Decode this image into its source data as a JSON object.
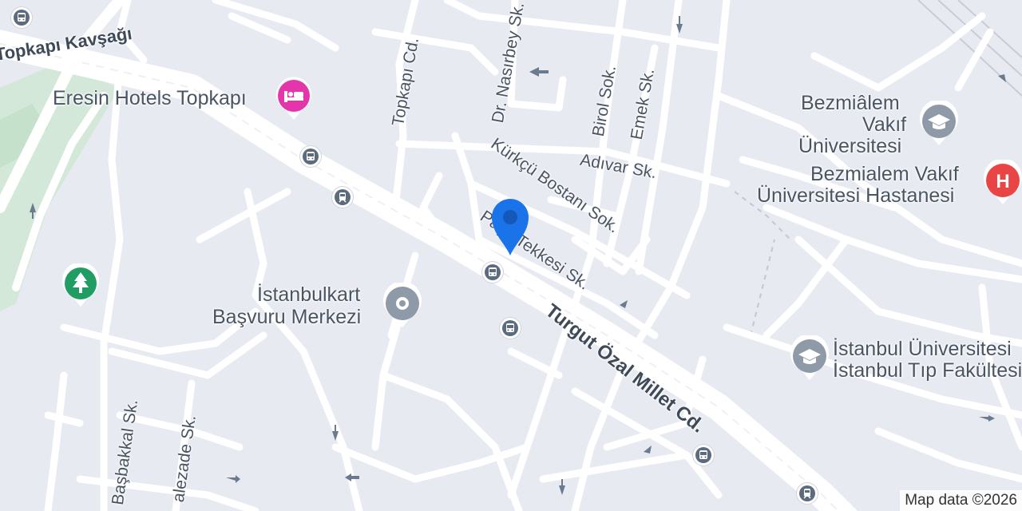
{
  "streets": {
    "topkapi_kavsagi": "Topkapı Kavşağı",
    "topkapi_cd": "Topkapı Cd.",
    "dr_nasirbey": "Dr. Nasırbey Sk.",
    "birol": "Birol Sok.",
    "emek": "Emek Sk.",
    "kurkcu": "Kürkçü Bostanı Sok.",
    "adivar": "Adıvar Sk.",
    "pasa_tekkesi": "Paşa Tekkesi Sk.",
    "turgut_ozal": "Turgut Özal Millet Cd.",
    "basbakkal": "Başbakkal Sk.",
    "alezade": "alezade Sk."
  },
  "pois": {
    "eresin": "Eresin Hotels Topkapı",
    "bezmialem_uni_1": "Bezmiâlem",
    "bezmialem_uni_2": "Vakıf",
    "bezmialem_uni_3": "Üniversitesi",
    "bezmialem_hosp_1": "Bezmialem Vakıf",
    "bezmialem_hosp_2": "Üniversitesi Hastanesi",
    "istanbulkart_1": "İstanbulkart",
    "istanbulkart_2": "Başvuru Merkezi",
    "istanbul_uni_1": "İstanbul Üniversitesi",
    "istanbul_uni_2": "İstanbul Tıp Fakültesi"
  },
  "icons": {
    "hotel": "hotel-icon",
    "university": "university-icon",
    "hospital": "hospital-icon",
    "park": "park-icon",
    "bus": "bus-stop-icon",
    "tram": "tram-stop-icon",
    "location": "location-pin-icon"
  },
  "colors": {
    "background": "#e8eaf2",
    "road": "#ffffff",
    "park": "#cfe6d4",
    "hotel_pin": "#e535ab",
    "hospital_pin": "#e94545",
    "location_pin": "#1a73e8",
    "poi_gray": "#8f9aa8"
  },
  "attribution": "Map data ©2026"
}
